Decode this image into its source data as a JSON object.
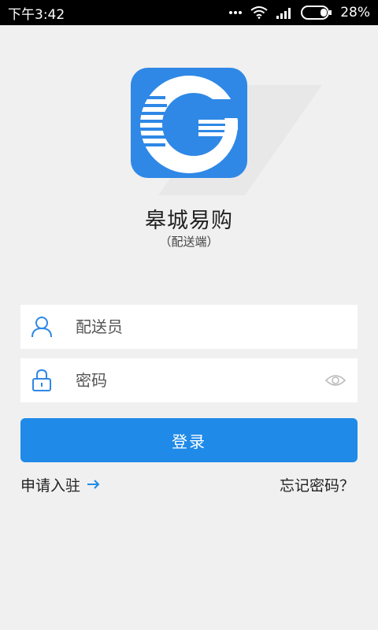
{
  "status_bar": {
    "time": "下午3:42",
    "battery": "28%"
  },
  "app": {
    "name": "皋城易购",
    "subtitle": "（配送端）"
  },
  "form": {
    "username_placeholder": "配送员",
    "password_placeholder": "密码"
  },
  "actions": {
    "login_label": "登录",
    "apply_label": "申请入驻",
    "forgot_label": "忘记密码？"
  },
  "colors": {
    "primary": "#1f8ae8",
    "background": "#f0f0f0",
    "icon_bg": "#2f88e6"
  }
}
